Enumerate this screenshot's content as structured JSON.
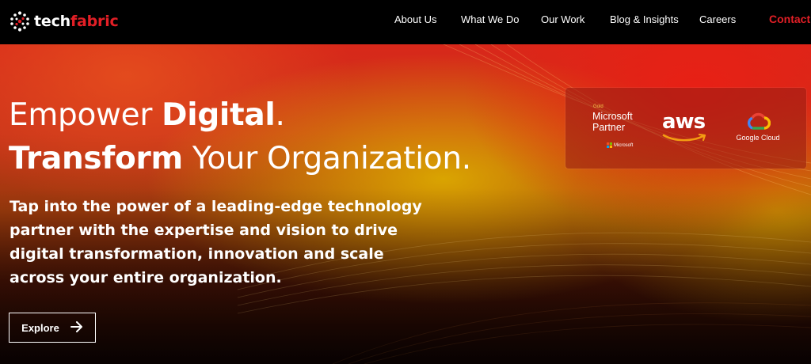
{
  "brand": {
    "logo_text_main": "tech",
    "logo_text_accent": "fabric",
    "accent_color": "#e21f26",
    "logo_icon": "dot-cluster-icon"
  },
  "nav": {
    "items": [
      {
        "label": "About Us"
      },
      {
        "label": "What We Do"
      },
      {
        "label": "Our Work"
      },
      {
        "label": "Blog & Insights"
      },
      {
        "label": "Careers"
      }
    ],
    "contact_label": "Contact"
  },
  "hero": {
    "headline_line1_light": "Empower ",
    "headline_line1_bold": "Digital",
    "headline_line1_end": ".",
    "headline_line2_bold": "Transform",
    "headline_line2_light": " Your Organization.",
    "lead": "Tap into the power of a leading-edge technology partner with the expertise and vision to drive digital transformation, innovation and scale across your entire organization.",
    "cta_label": "Explore",
    "cta_icon": "arrow-right-icon"
  },
  "partners": {
    "microsoft_gold": "Gold",
    "microsoft_title": "Microsoft Partner",
    "microsoft_sub": "Microsoft",
    "aws_text": "aws",
    "google_text": "Google Cloud"
  }
}
